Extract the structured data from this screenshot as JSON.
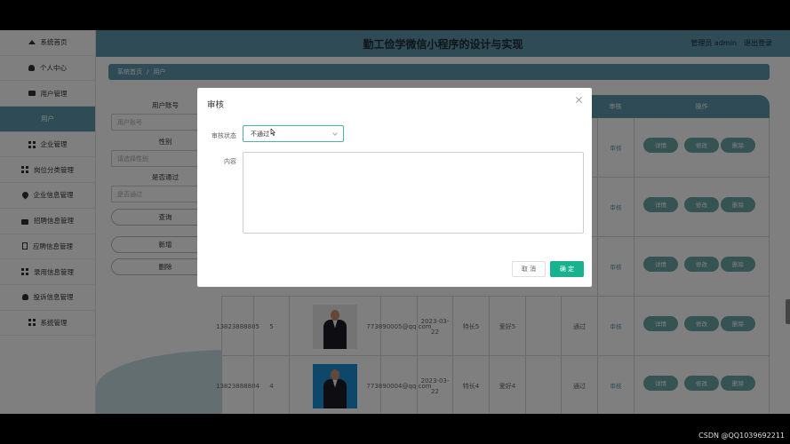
{
  "header": {
    "title": "勤工俭学微信小程序的设计与实现",
    "user": "管理员 admin",
    "logout": "退出登录"
  },
  "sidebar": {
    "items": [
      {
        "label": "系统首页",
        "icon": "home-icon"
      },
      {
        "label": "个人中心",
        "icon": "user-icon"
      },
      {
        "label": "用户管理",
        "icon": "monitor-icon"
      },
      {
        "label": "用户",
        "icon": ""
      },
      {
        "label": "企业管理",
        "icon": "grid-icon"
      },
      {
        "label": "岗位分类管理",
        "icon": "grid-icon"
      },
      {
        "label": "企业信息管理",
        "icon": "pin-icon"
      },
      {
        "label": "招聘信息管理",
        "icon": "bag-icon"
      },
      {
        "label": "应聘信息管理",
        "icon": "document-icon"
      },
      {
        "label": "录用信息管理",
        "icon": "grid-icon"
      },
      {
        "label": "投诉信息管理",
        "icon": "user-icon"
      },
      {
        "label": "系统管理",
        "icon": "grid-icon"
      }
    ]
  },
  "breadcrumb": {
    "home": "系统首页",
    "separator": "/",
    "current": "用户"
  },
  "search": {
    "account_label": "用户账号",
    "account_placeholder": "用户账号",
    "gender_label": "性别",
    "gender_placeholder": "请选择性别",
    "pass_label": "是否通过",
    "pass_placeholder": "是否通过",
    "query_button": "查询",
    "add_button": "新增",
    "delete_button": "删除"
  },
  "table": {
    "audit_header": "审核",
    "ops_header": "操作",
    "rows": [
      {
        "account": "",
        "id": "",
        "email": "",
        "date": "",
        "specialty": "",
        "hobby": "",
        "pass": "",
        "photo": ""
      },
      {
        "account": "",
        "id": "",
        "email": "",
        "date": "",
        "specialty": "",
        "hobby": "",
        "pass": "",
        "photo": ""
      },
      {
        "account": "",
        "id": "",
        "email": "",
        "date": "",
        "specialty": "",
        "hobby": "",
        "pass": "",
        "photo": ""
      },
      {
        "account": "13823888885",
        "id": "5",
        "email": "773890005@qq.com",
        "date": "2023-03-22",
        "specialty": "特长5",
        "hobby": "爱好5",
        "pass": "通过",
        "photo": "grey"
      },
      {
        "account": "13823888884",
        "id": "4",
        "email": "773890004@qq.com",
        "date": "2023-03-22",
        "specialty": "特长4",
        "hobby": "爱好4",
        "pass": "通过",
        "photo": "blue"
      }
    ],
    "audit_link": "审核",
    "detail_button": "详情",
    "edit_button": "修改",
    "delete_button": "删除"
  },
  "modal": {
    "title": "审核",
    "status_label": "审核状态",
    "status_value": "不通过",
    "content_label": "内容",
    "content_value": "",
    "cancel_button": "取 消",
    "confirm_button": "确 定"
  },
  "watermark": "CSDN @QQ1039692211",
  "colors": {
    "accent": "#5c97ac",
    "confirm": "#18b28e",
    "op_button": "#6aa7a7"
  }
}
